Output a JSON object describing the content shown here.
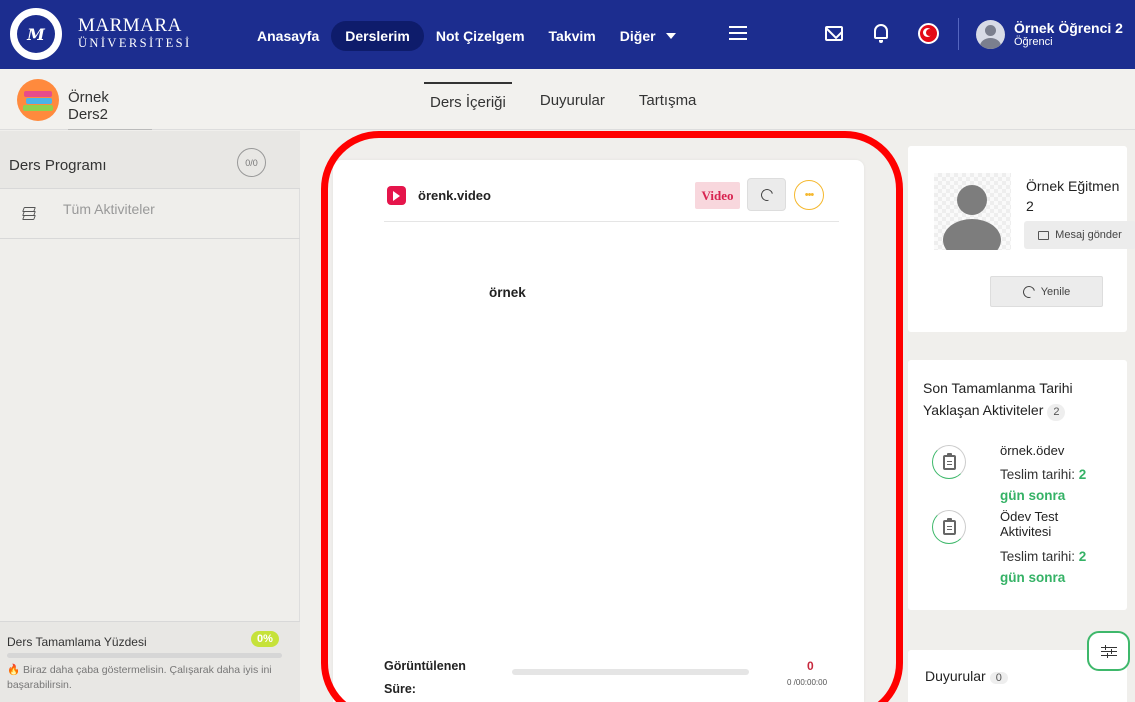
{
  "topbar": {
    "logo_text": "M",
    "brand_line1": "MARMARA",
    "brand_line2": "ÜNİVERSİTESİ",
    "nav": [
      "Anasayfa",
      "Derslerim",
      "Not Çizelgem",
      "Takvim",
      "Diğer"
    ],
    "active_nav": "Derslerim",
    "user_name": "Örnek Öğrenci 2",
    "user_role": "Öğrenci",
    "accent": "#1c2d8f"
  },
  "course": {
    "name": "Örnek Ders2",
    "tabs": [
      "Ders İçeriği",
      "Duyurular",
      "Tartışma"
    ],
    "active_tab": "Ders İçeriği"
  },
  "left_panel": {
    "title": "Ders Programı",
    "count": "0/0",
    "row_label": "Tüm Aktiviteler",
    "completion_title": "Ders Tamamlama Yüzdesi",
    "completion_pct": "0%",
    "completion_value": 0,
    "hint": "Biraz daha çaba göstermelisin. Çalışarak daha iyis ini başarabilirsin."
  },
  "activity": {
    "title": "örenk.video",
    "type_badge": "Video",
    "content": "örnek",
    "watched_label": "Görüntülenen Süre:",
    "watched_count": "0",
    "watched_time": "0 /00:00:00",
    "watched_progress": 0
  },
  "teacher": {
    "name": "Örnek Eğitmen 2",
    "message_button": "Mesaj gönder",
    "refresh_button": "Yenile"
  },
  "upcoming": {
    "title_line1": "Son Tamamlanma Tarihi",
    "title_line2": "Yaklaşan Aktiviteler",
    "count": "2",
    "items": [
      {
        "name": "örnek.ödev",
        "due_label": "Teslim tarihi:",
        "due_value": "2 gün sonra"
      },
      {
        "name": "Ödev Test Aktivitesi",
        "due_label": "Teslim tarihi:",
        "due_value": "2 gün sonra"
      }
    ]
  },
  "announcements": {
    "title": "Duyurular",
    "count": "0"
  }
}
